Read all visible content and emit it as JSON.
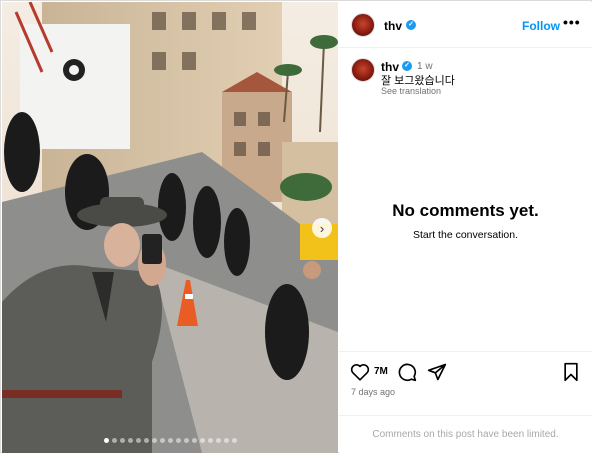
{
  "post": {
    "username": "thv",
    "verified_mark": "✓",
    "follow_label": "Follow",
    "more_label": "•••",
    "caption_username": "thv",
    "caption_time": "1 w",
    "caption_text": "잘 보그왔습니다",
    "see_translation": "See translation"
  },
  "comments": {
    "empty_title": "No comments yet.",
    "empty_subtitle": "Start the conversation.",
    "limited_notice": "Comments on this post have been limited."
  },
  "actions": {
    "likes": "7M",
    "posted_ago": "7 days ago",
    "icons": [
      "heart-icon",
      "comment-icon",
      "share-icon",
      "bookmark-icon"
    ]
  },
  "carousel": {
    "next_glyph": "›",
    "slide_count": 17,
    "active_index": 0
  },
  "colors": {
    "link": "#0095f6",
    "muted": "#737373",
    "verified": "#1d9bf0"
  }
}
